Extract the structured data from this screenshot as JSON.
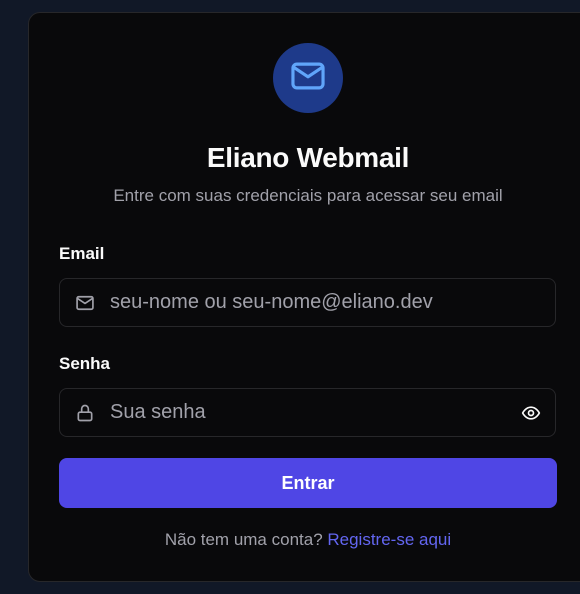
{
  "brand": {
    "title": "Eliano Webmail",
    "subtitle": "Entre com suas credenciais para acessar seu email",
    "logo_icon": "mail-icon"
  },
  "form": {
    "email_label": "Email",
    "email_placeholder": "seu-nome ou seu-nome@eliano.dev",
    "email_value": "",
    "email_icon": "mail-icon",
    "password_label": "Senha",
    "password_placeholder": "Sua senha",
    "password_value": "",
    "password_icon": "lock-icon",
    "toggle_visibility_icon": "eye-icon",
    "submit_label": "Entrar"
  },
  "footer": {
    "prompt": "Não tem uma conta?",
    "register_link": "Registre-se aqui"
  },
  "colors": {
    "background": "#111827",
    "card": "#09090b",
    "accent": "#4f46e5",
    "link": "#6366f1",
    "logo_bg": "#1e3a8a",
    "logo_icon": "#60a5fa"
  }
}
